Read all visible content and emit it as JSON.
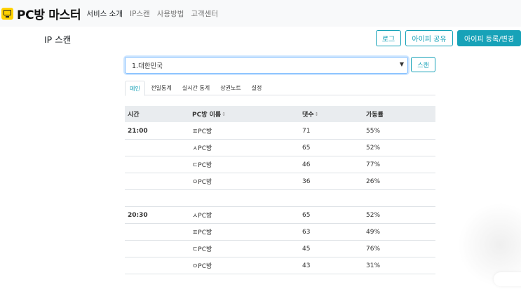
{
  "navbar": {
    "brand": "PC방 마스터",
    "links": [
      "서비스 소개",
      "IP스캔",
      "사용방법",
      "고객센터"
    ]
  },
  "page_title": "IP 스캔",
  "buttons": {
    "log": "로그",
    "share_ip": "아이피 공유",
    "register_ip": "아이피 등록/변경",
    "scan": "스캔"
  },
  "region_select": {
    "value": "1.대한민국"
  },
  "tabs": [
    "메인",
    "전일통계",
    "실시간 통계",
    "상권노트",
    "설정"
  ],
  "table": {
    "headers": [
      "시간",
      "PC방 이름",
      "댓수",
      "가동률"
    ],
    "groups": [
      {
        "time": "21:00",
        "rows": [
          {
            "name": "ㅍPC방",
            "count": "71",
            "rate": "55%"
          },
          {
            "name": "ㅅPC방",
            "count": "65",
            "rate": "52%"
          },
          {
            "name": "ㄷPC방",
            "count": "46",
            "rate": "77%"
          },
          {
            "name": "ㅇPC방",
            "count": "36",
            "rate": "26%"
          }
        ]
      },
      {
        "time": "20:30",
        "rows": [
          {
            "name": "ㅅPC방",
            "count": "65",
            "rate": "52%"
          },
          {
            "name": "ㅍPC방",
            "count": "63",
            "rate": "49%"
          },
          {
            "name": "ㄷPC방",
            "count": "45",
            "rate": "76%"
          },
          {
            "name": "ㅇPC방",
            "count": "43",
            "rate": "31%"
          }
        ]
      }
    ]
  },
  "colors": {
    "accent": "#17a2b8",
    "brand_icon": "#ffd200",
    "header_bg": "#e9ecef"
  }
}
